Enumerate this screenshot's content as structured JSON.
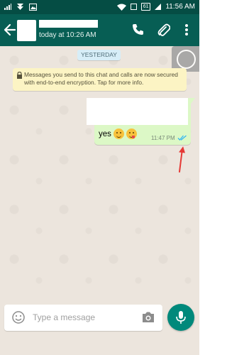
{
  "status_bar": {
    "battery": "61",
    "time": "11:56 AM"
  },
  "header": {
    "last_seen": "today at 10:26 AM"
  },
  "chat": {
    "date_chip": "YESTERDAY",
    "encryption_notice": "Messages you send to this chat and calls are now secured with end-to-end encryption. Tap for more info.",
    "message": {
      "text": "yes",
      "time": "11:47 PM",
      "status": "read"
    }
  },
  "composer": {
    "placeholder": "Type a message"
  },
  "colors": {
    "header": "#075e54",
    "status_bar": "#054d44",
    "outgoing_bubble": "#dcf8c6",
    "notice": "#fcf4c4",
    "read_ticks": "#34b7f1",
    "mic_button": "#00897b",
    "annotation_arrow": "#e53935"
  }
}
